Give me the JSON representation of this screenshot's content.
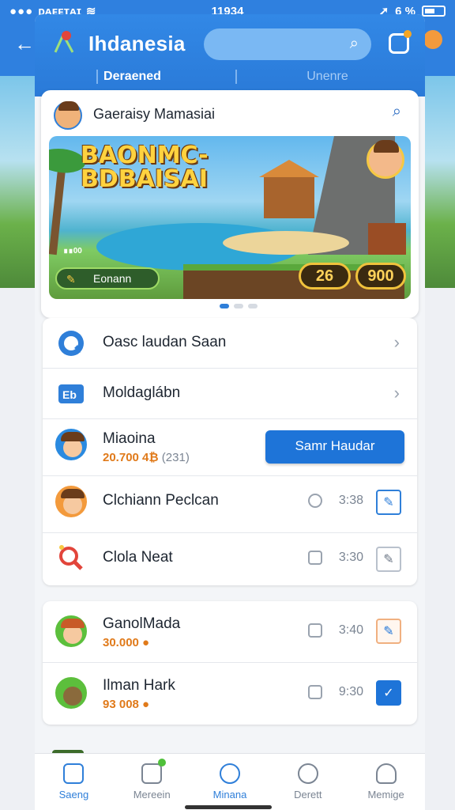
{
  "status_bar": {
    "carrier": "ᴅᴀᴇᴇᴛᴀɪ",
    "time": "11934",
    "battery": "6 %"
  },
  "header": {
    "title": "Ihdanesia",
    "tabs": [
      {
        "label": "Deraened",
        "active": true
      },
      {
        "label": "Unenre",
        "active": false
      }
    ]
  },
  "featured": {
    "title": "Gaeraisy Mamasiai",
    "banner_title": "BAONMC-\nBDBAISAI",
    "badge_label": "Eonann",
    "mini_text": "∎∎00",
    "coin_small": "26",
    "coin_large": "900",
    "carousel_pages": 3,
    "carousel_active": 0
  },
  "list_group_1": [
    {
      "label": "Oasc laudan Saan",
      "icon": "chat-icon"
    },
    {
      "label": "Moldaglábn",
      "icon": "bot-icon"
    },
    {
      "label": "Miaoina",
      "sub_amount": "20.700 4₿",
      "sub_extra": "(231)",
      "action": "Samr Haudar",
      "icon": "avatar"
    },
    {
      "label": "Clchiann Peclcan",
      "time": "3:38",
      "icon": "avatar"
    },
    {
      "label": "Clola Neat",
      "time": "3:30",
      "icon": "search-icon"
    }
  ],
  "list_group_2": [
    {
      "label": "GanolMada",
      "sub_amount": "30.000 ●",
      "time": "3:40"
    },
    {
      "label": "Ilman Hark",
      "sub_amount": "93 008 ●",
      "time": "9:30"
    }
  ],
  "bottom_nav": [
    {
      "label": "Saeng",
      "active": true
    },
    {
      "label": "Mereein",
      "active": false
    },
    {
      "label": "Minana",
      "active": false
    },
    {
      "label": "Derett",
      "active": false
    },
    {
      "label": "Memige",
      "active": false
    }
  ],
  "colors": {
    "brand": "#2f80df",
    "accent_orange": "#e07a1a",
    "cta": "#1e74d8"
  }
}
